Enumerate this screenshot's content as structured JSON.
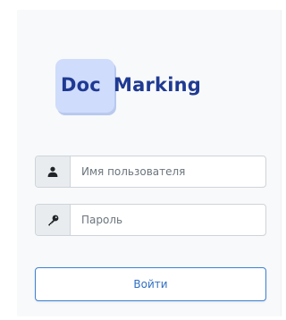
{
  "logo": {
    "part1": "Doc",
    "part2": "Marking"
  },
  "form": {
    "username": {
      "icon": "user-icon",
      "placeholder": "Имя пользователя",
      "value": ""
    },
    "password": {
      "icon": "key-icon",
      "placeholder": "Пароль",
      "value": ""
    },
    "submit_label": "Войти"
  },
  "colors": {
    "brand_text": "#1f3a93",
    "logo_box": "#cfdcfb",
    "button_border": "#3b82d6",
    "addon_bg": "#e9ecef"
  }
}
